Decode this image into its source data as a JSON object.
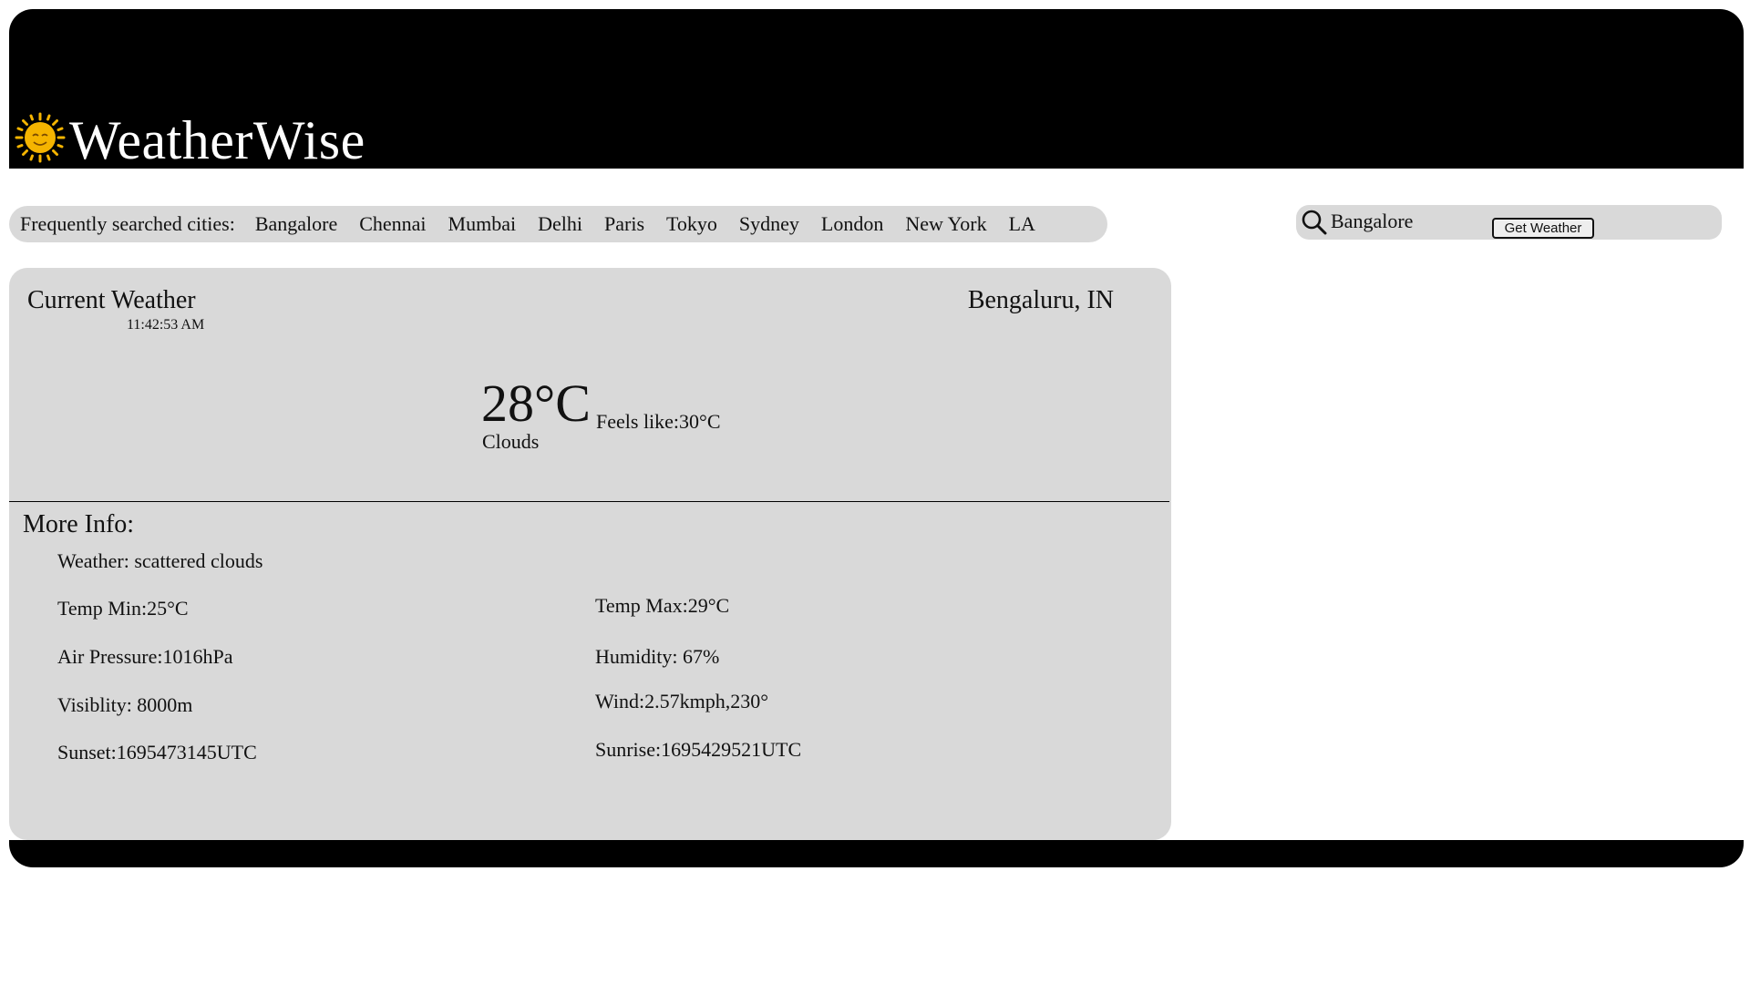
{
  "header": {
    "app_title": "WeatherWise",
    "logo_icon": "sun-smiley-icon",
    "background": "#000000",
    "sun_color": "#f5b400"
  },
  "cities": {
    "label": "Frequently searched cities:",
    "items": [
      "Bangalore",
      "Chennai",
      "Mumbai",
      "Delhi",
      "Paris",
      "Tokyo",
      "Sydney",
      "London",
      "New York",
      "LA"
    ]
  },
  "search": {
    "value": "Bangalore",
    "icon": "search-icon",
    "button_label": "Get Weather"
  },
  "current": {
    "title": "Current Weather",
    "time": "11:42:53 AM",
    "location": "Bengaluru, IN",
    "temperature": "28°C",
    "condition": "Clouds",
    "feels_like": "Feels like:30°C"
  },
  "more_info": {
    "title": "More Info:",
    "weather": "Weather: scattered clouds",
    "temp_min": "Temp Min:25°C",
    "temp_max": "Temp Max:29°C",
    "air_pressure": "Air Pressure:1016hPa",
    "humidity": "Humidity: 67%",
    "visibility": "Visiblity: 8000m",
    "wind": "Wind:2.57kmph,230°",
    "sunset": "Sunset:1695473145UTC",
    "sunrise": "Sunrise:1695429521UTC"
  },
  "colors": {
    "panel": "#d9d9d9",
    "bar": "#000000"
  }
}
